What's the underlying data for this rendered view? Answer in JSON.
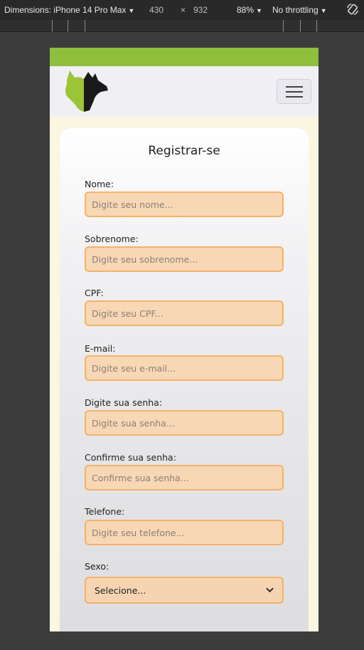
{
  "devtools": {
    "dimensions_label": "Dimensions: iPhone 14 Pro Max",
    "width": "430",
    "times": "×",
    "height": "932",
    "zoom": "88%",
    "throttling": "No throttling"
  },
  "form": {
    "title": "Registrar-se",
    "fields": [
      {
        "label": "Nome:",
        "placeholder": "Digite seu nome..."
      },
      {
        "label": "Sobrenome:",
        "placeholder": "Digite seu sobrenome..."
      },
      {
        "label": "CPF:",
        "placeholder": "Digite seu CPF..."
      },
      {
        "label": "E-mail:",
        "placeholder": "Digite seu e-mail..."
      },
      {
        "label": "Digite sua senha:",
        "placeholder": "Digite sua senha..."
      },
      {
        "label": "Confirme sua senha:",
        "placeholder": "Confirme sua senha..."
      },
      {
        "label": "Telefone:",
        "placeholder": "Digite seu telefone..."
      }
    ],
    "sexo": {
      "label": "Sexo:",
      "selected": "Selecione..."
    }
  },
  "colors": {
    "topbar": "#8fbf3d",
    "input_bg": "#f8d7b5",
    "input_border": "#f3b26a",
    "page_bg": "#fbf6e1"
  },
  "icons": {
    "logo": "cat-dog-logo",
    "menu": "hamburger-icon",
    "rotate": "rotate-icon"
  }
}
